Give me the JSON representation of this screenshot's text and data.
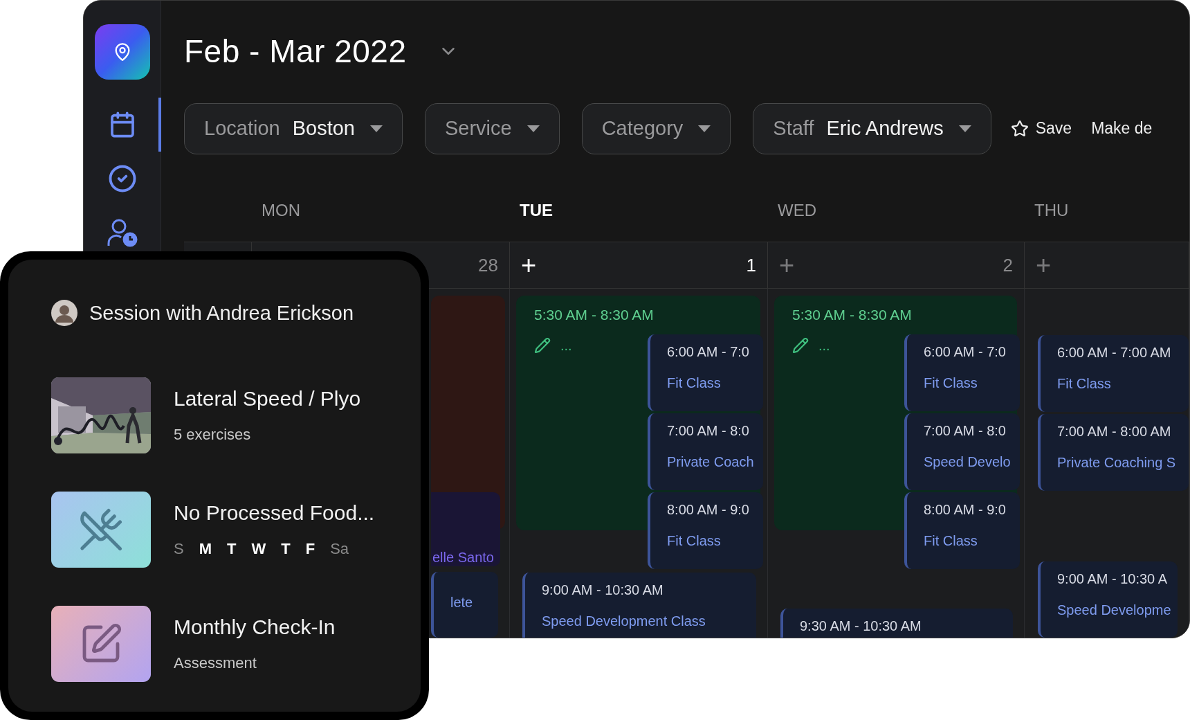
{
  "sidebar": {
    "nav": [
      {
        "kind": "calendar",
        "selected": true
      },
      {
        "kind": "tasks",
        "selected": false
      },
      {
        "kind": "clients",
        "selected": false
      }
    ]
  },
  "header": {
    "title": "Feb - Mar 2022"
  },
  "filters": [
    {
      "label": "Location",
      "value": "Boston"
    },
    {
      "label": "Service"
    },
    {
      "label": "Category"
    },
    {
      "label": "Staff",
      "value": "Eric Andrews"
    }
  ],
  "actions": [
    {
      "kind": "save",
      "label": "Save"
    },
    {
      "kind": "link",
      "label": "Make de"
    }
  ],
  "days": [
    {
      "name": "MON",
      "date": "28",
      "selected": false,
      "block": {
        "kind": "busy",
        "sessions": [
          {
            "kind": "personal",
            "title": "elle Santo"
          }
        ]
      },
      "events": [
        {
          "kind": "session",
          "title": "lete"
        }
      ]
    },
    {
      "name": "TUE",
      "date": "1",
      "plus": "+",
      "selected": true,
      "block": {
        "kind": "availability",
        "time": "5:30 AM - 8:30 AM",
        "more": "...",
        "sessions": [
          {
            "kind": "session",
            "time": "6:00 AM - 7:0",
            "title": "Fit Class"
          },
          {
            "kind": "session",
            "time": "7:00 AM - 8:0",
            "title": "Private Coach"
          },
          {
            "kind": "session",
            "time": "8:00 AM - 9:0",
            "title": "Fit Class"
          }
        ]
      },
      "events": [
        {
          "kind": "session",
          "time": "9:00 AM - 10:30 AM",
          "title": "Speed Development Class"
        }
      ]
    },
    {
      "name": "WED",
      "date": "2",
      "plus": "+",
      "selected": false,
      "block": {
        "kind": "availability",
        "time": "5:30 AM - 8:30 AM",
        "more": "...",
        "sessions": [
          {
            "kind": "session",
            "time": "6:00 AM - 7:0",
            "title": "Fit Class"
          },
          {
            "kind": "session",
            "time": "7:00 AM - 8:0",
            "title": "Speed Develo"
          },
          {
            "kind": "session",
            "time": "8:00 AM - 9:0",
            "title": "Fit Class"
          }
        ]
      },
      "events": [
        {
          "kind": "session",
          "time": "9:30 AM - 10:30 AM"
        }
      ]
    },
    {
      "name": "THU",
      "plus": "+",
      "selected": false,
      "block": {
        "kind": "open",
        "sessions": [
          {
            "kind": "session",
            "time": "6:00 AM - 7:00 AM",
            "title": "Fit Class"
          },
          {
            "kind": "session",
            "time": "7:00 AM - 8:00 AM",
            "title": "Private Coaching S"
          }
        ]
      },
      "events": [
        {
          "kind": "session",
          "time": "9:00 AM - 10:30 A",
          "title": "Speed Developme"
        }
      ]
    }
  ],
  "session_card": {
    "title": "Session with Andrea Erickson",
    "items": [
      {
        "title": "Lateral Speed / Plyo",
        "subtitle": "5 exercises"
      },
      {
        "kind": "nutrition",
        "title": "No Processed Food...",
        "days": [
          {
            "label": "S",
            "selected": false
          },
          {
            "label": "M",
            "selected": true
          },
          {
            "label": "T",
            "selected": true
          },
          {
            "label": "W",
            "selected": true
          },
          {
            "label": "T",
            "selected": true
          },
          {
            "label": "F",
            "selected": true
          },
          {
            "label": "Sa",
            "selected": false
          }
        ]
      },
      {
        "kind": "assessment",
        "title": "Monthly Check-In",
        "subtitle": "Assessment"
      }
    ]
  }
}
